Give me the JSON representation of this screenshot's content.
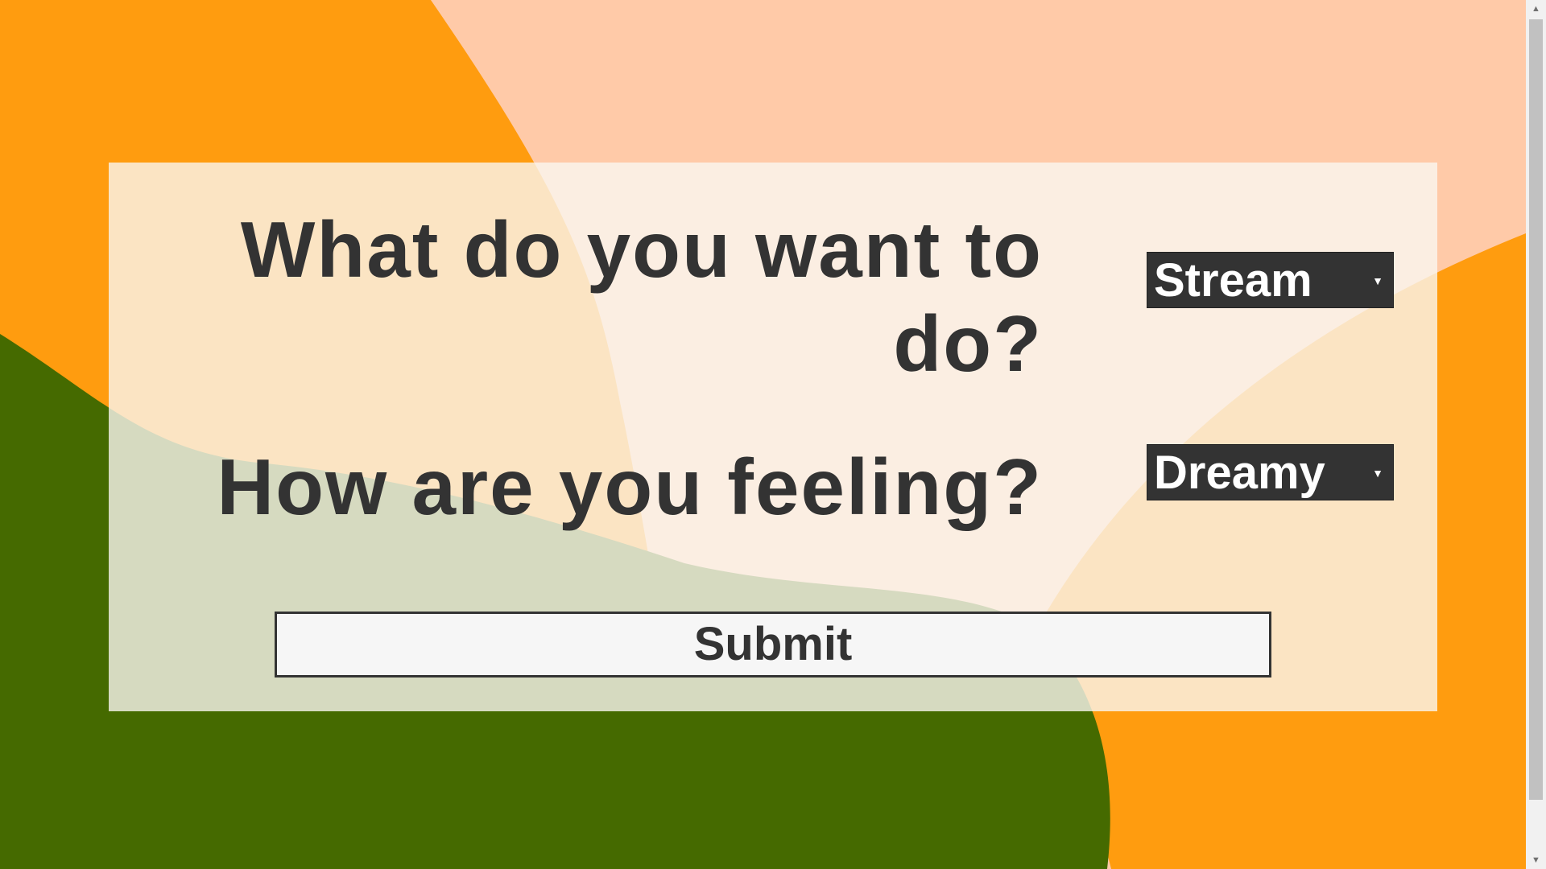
{
  "theme": {
    "orange": "#ff9c0f",
    "peach": "#ffcaa8",
    "green": "#456a00",
    "card": "#faf6f0",
    "text": "#333333"
  },
  "form": {
    "question_activity": "What do you want to do?",
    "activity_selected": "Stream",
    "question_mood": "How are you feeling?",
    "mood_selected": "Dreamy",
    "submit_label": "Submit"
  },
  "icons": {
    "dropdown": "chevron-down-icon",
    "scroll_up": "arrow-up-icon",
    "scroll_down": "arrow-down-icon"
  }
}
